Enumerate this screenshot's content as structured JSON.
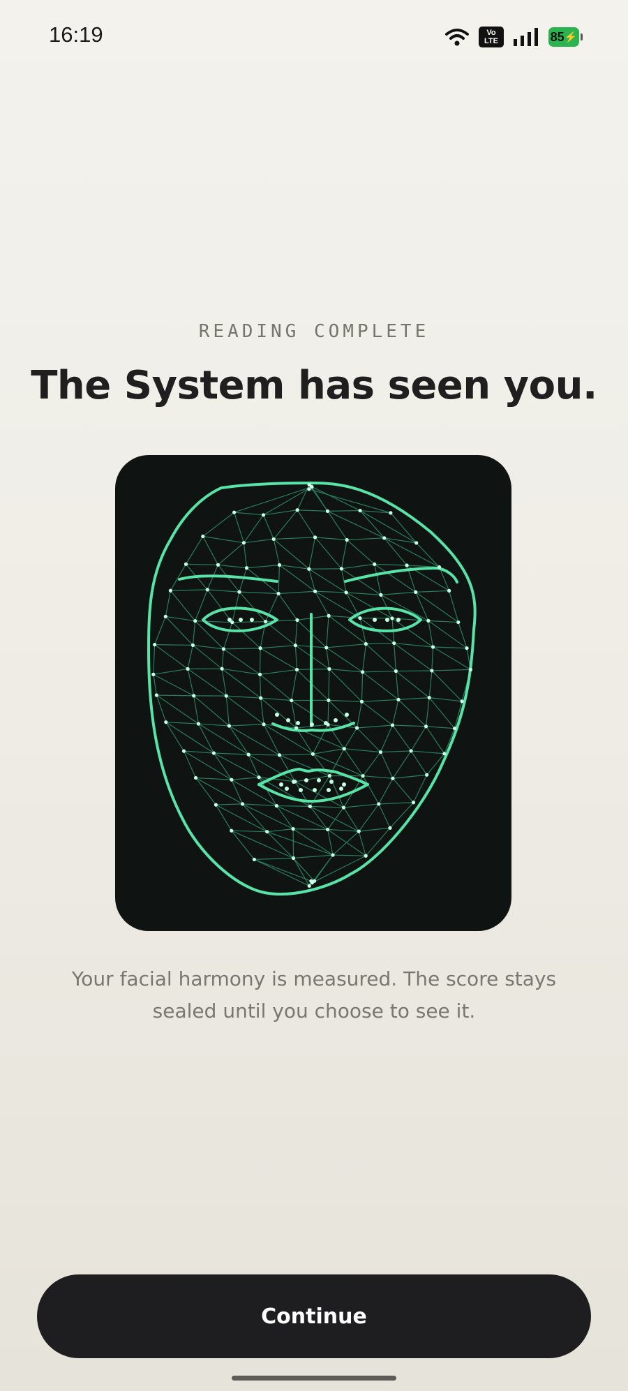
{
  "status_bar": {
    "time": "16:19",
    "volte_top": "Vo",
    "volte_bottom": "LTE",
    "battery": "85",
    "icons": [
      "wifi-icon",
      "volte-icon",
      "signal-icon",
      "battery-icon"
    ],
    "battery_color": "#2bb34f"
  },
  "header": {
    "eyebrow": "READING COMPLETE",
    "title": "The System has seen you."
  },
  "face_scan": {
    "image": "face-mesh-illustration",
    "mesh_color": "#3fd29a"
  },
  "caption": "Your facial harmony is measured. The score stays sealed until you choose to see it.",
  "actions": {
    "continue_label": "Continue"
  }
}
